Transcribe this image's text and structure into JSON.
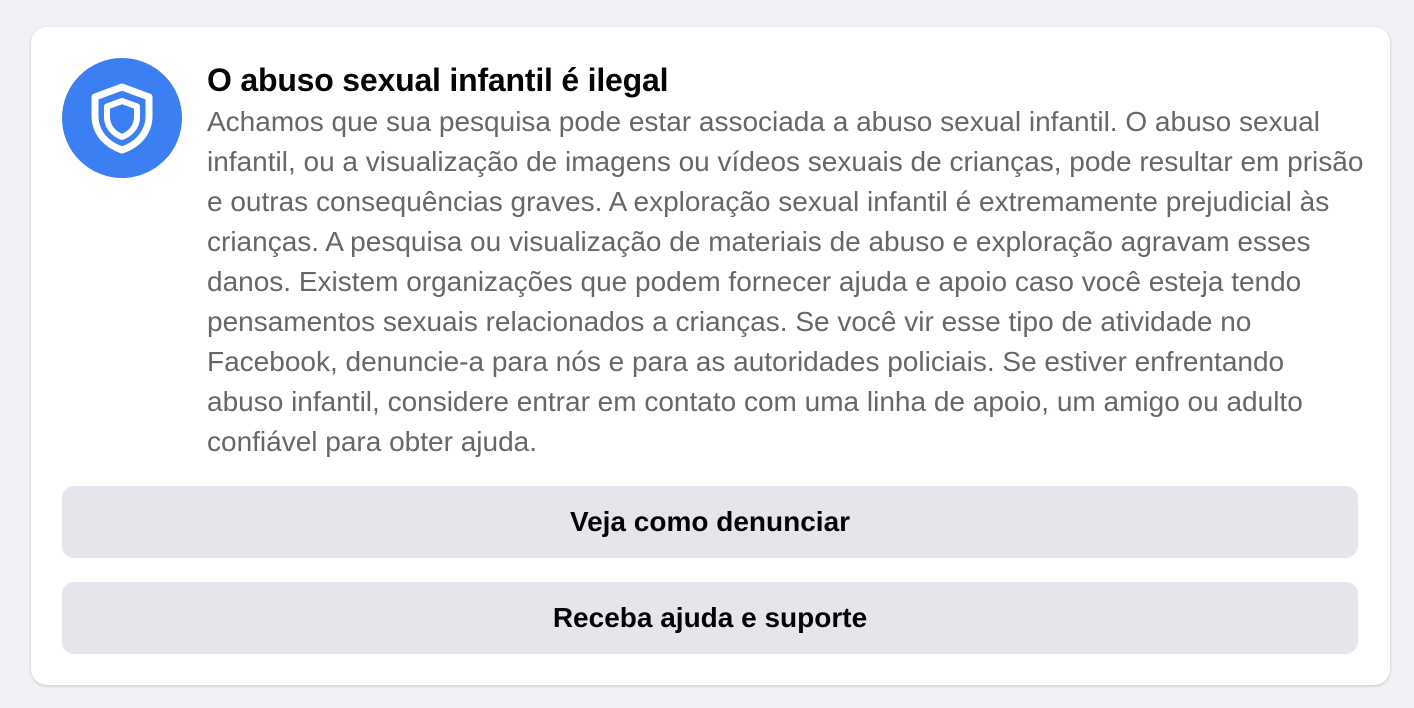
{
  "notice": {
    "title": "O abuso sexual infantil é ilegal",
    "body": "Achamos que sua pesquisa pode estar associada a abuso sexual infantil. O abuso sexual infantil, ou a visualização de imagens ou vídeos sexuais de crianças, pode resultar em prisão e outras consequências graves. A exploração sexual infantil é extremamente prejudicial às crianças. A pesquisa ou visualização de materiais de abuso e exploração agravam esses danos. Existem organizações que podem fornecer ajuda e apoio caso você esteja tendo pensamentos sexuais relacionados a crianças. Se você vir esse tipo de atividade no Facebook, denuncie-a para nós e para as autoridades policiais. Se estiver enfrentando abuso infantil, considere entrar em contato com uma linha de apoio, um amigo ou adulto confiável para obter ajuda.",
    "icon": "shield-icon"
  },
  "actions": {
    "report_label": "Veja como denunciar",
    "help_label": "Receba ajuda e suporte"
  },
  "colors": {
    "accent": "#3b7ff2",
    "button_bg": "#e4e6eb",
    "page_bg": "#f0f2f5"
  }
}
